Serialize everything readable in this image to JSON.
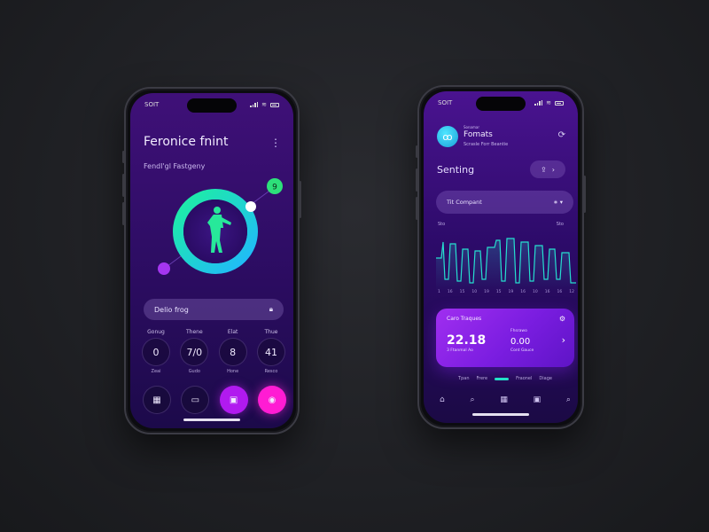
{
  "phone1": {
    "status": {
      "time": "SOIT"
    },
    "title": "Feronice fnint",
    "menu_icon": "kebab-menu-icon",
    "subtitle": "Fendl'gl Fastgeny",
    "ring_badge": "9",
    "field": {
      "label": "Delio frog",
      "icon": "lock-icon"
    },
    "stats": [
      {
        "label": "Gonug",
        "value": "0",
        "sub": "Zeai"
      },
      {
        "label": "Thene",
        "value": "7/0",
        "sub": "Gudo"
      },
      {
        "label": "Elat",
        "value": "8",
        "sub": "Hone"
      },
      {
        "label": "Thue",
        "value": "41",
        "sub": "Resco"
      }
    ],
    "actions": [
      {
        "icon": "calendar-icon",
        "glyph": "▦"
      },
      {
        "icon": "folder-icon",
        "glyph": "▭"
      },
      {
        "icon": "chat-icon",
        "glyph": "▣"
      },
      {
        "icon": "target-icon",
        "glyph": "◉"
      }
    ],
    "colors": {
      "ring_start": "#1ef0a0",
      "ring_end": "#20b7ff",
      "accent_pink": "#ff1cd3",
      "accent_magenta": "#b11aef"
    }
  },
  "phone2": {
    "status": {
      "time": "SOIT"
    },
    "brand_small": "Sonamar",
    "brand": "Fomats",
    "brand_sub": "Scrasle Forr Beantie",
    "section_title": "Senting",
    "select": {
      "label": "Tit Compant",
      "icons": "∗ ▾"
    },
    "chart_labels": {
      "left": "Sto",
      "right": "Sto"
    },
    "x_ticks": [
      "1",
      "16",
      "15",
      "10",
      "19",
      "15",
      "19",
      "16",
      "10",
      "16",
      "16",
      "12"
    ],
    "card": {
      "title": "Caro Traques",
      "value1": "22.18",
      "sub1": "3 Ftanmal Ao",
      "label2": "Fhsrawo",
      "value2": "0.00",
      "sub2": "Cont Gauce"
    },
    "tabs": [
      "Tpan",
      "Frere",
      "Fraonel",
      "Diage"
    ],
    "nav_icons": [
      "home-icon",
      "search-icon",
      "grid-icon",
      "bookmark-icon",
      "search-icon"
    ],
    "colors": {
      "line": "#26dfd0",
      "card": "#9a2cf0"
    }
  }
}
